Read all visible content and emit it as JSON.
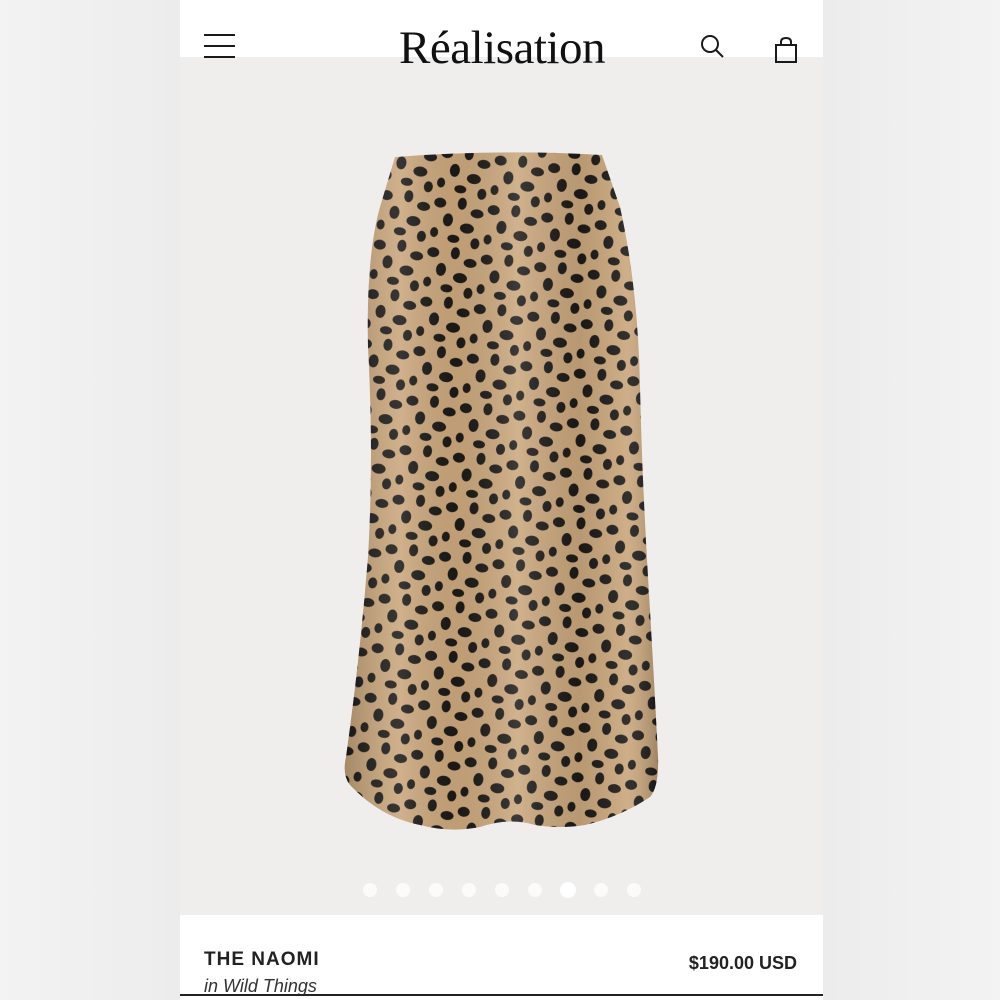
{
  "header": {
    "brand": "Réalisation",
    "menu_icon": "hamburger-menu-icon",
    "search_icon": "search-icon",
    "bag_icon": "shopping-bag-icon"
  },
  "gallery": {
    "image_description_icon": "product-image",
    "slide_count": 9,
    "active_slide": 7
  },
  "product": {
    "name": "THE NAOMI",
    "collection": "in Wild Things",
    "price": "$190.00 USD"
  },
  "colors": {
    "skirt_base": "#c8a57a",
    "spots": "#1c1a18",
    "gallery_bg": "#efeeed"
  }
}
